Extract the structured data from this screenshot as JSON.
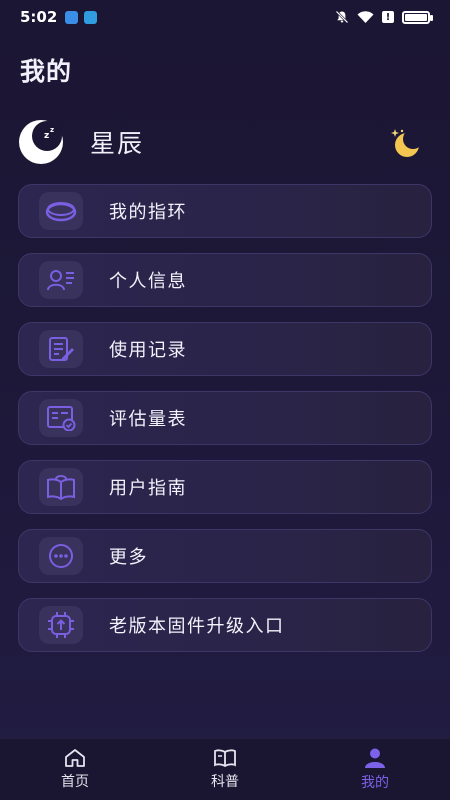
{
  "status_bar": {
    "time": "5:02",
    "battery_level": 0.9,
    "alert_glyph": "!"
  },
  "page": {
    "title": "我的"
  },
  "profile": {
    "name": "星辰",
    "avatar_icon": "sleeping-moon-icon",
    "night_icon": "moon-star-icon"
  },
  "menu": {
    "items": [
      {
        "label": "我的指环",
        "icon": "ring-icon"
      },
      {
        "label": "个人信息",
        "icon": "person-card-icon"
      },
      {
        "label": "使用记录",
        "icon": "edit-document-icon"
      },
      {
        "label": "评估量表",
        "icon": "scale-check-icon"
      },
      {
        "label": "用户指南",
        "icon": "guide-book-icon"
      },
      {
        "label": "更多",
        "icon": "more-dots-icon"
      },
      {
        "label": "老版本固件升级入口",
        "icon": "chip-upgrade-icon"
      }
    ]
  },
  "tabs": [
    {
      "label": "首页",
      "icon": "home-icon"
    },
    {
      "label": "科普",
      "icon": "book-icon"
    },
    {
      "label": "我的",
      "icon": "user-icon",
      "active": true
    }
  ],
  "colors": {
    "accent": "#7c62e8",
    "icon_purple": "#7a5fe0",
    "background": "#1d1838",
    "card": "#2c2650"
  }
}
